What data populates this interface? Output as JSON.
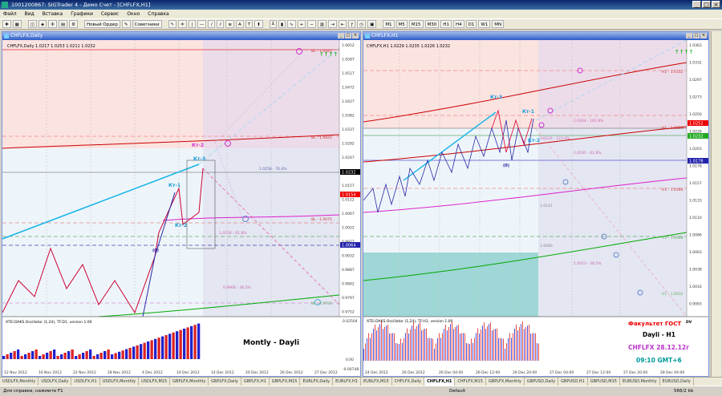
{
  "app": {
    "title": "1001200867: SIGTrader 4 - Демо Счет - [CHFLFX,H1]"
  },
  "menu": [
    "Файл",
    "Вид",
    "Вставка",
    "Графики",
    "Сервис",
    "Окно",
    "Справка"
  ],
  "toolbar": {
    "new_order": "Новый Ордер",
    "advisors": "Советники",
    "timeframes": [
      "M1",
      "M5",
      "M15",
      "M30",
      "H1",
      "H4",
      "D1",
      "W1",
      "MN"
    ]
  },
  "left_chart": {
    "title": "CHFLFX,Daily",
    "info": "CHFLFX,Daily 1.0217 1.0253 1.0211 1.0232",
    "price_scale": [
      "1.0652",
      "1.0587",
      "1.0517",
      "1.0472",
      "1.0427",
      "1.0382",
      "1.0337",
      "1.0292",
      "1.0247",
      "1.0202",
      "1.0157",
      "1.0112",
      "1.0067",
      "1.0022",
      "0.9977",
      "0.9932",
      "0.9887",
      "0.9842",
      "0.9797",
      "0.9752"
    ],
    "current_price": "1.0232",
    "red_tag": "1.0154",
    "blue_tag": "1.0064",
    "level_labels": [
      "BL - 1.0441",
      "BL - 1.0075",
      "1.0258 - 76.4%",
      "1.0156 - 61.8%",
      "1.0088 - 50.0%",
      "0.9908 - 38.2%",
      "BL - 0.9781"
    ],
    "wave_labels": {
      "kr2": "Кт-2",
      "kr3": "Кт-3",
      "kr1": "Кт-1",
      "kr2b": "Кт-2",
      "zero": "(0)"
    },
    "osc_title": "ATEI.DAKS.Oscillator (1,24), TF:D1, version 1.00",
    "osc_scale": [
      "0.02504",
      "0.00",
      "-0.00748"
    ],
    "note": "Montly - Dayli",
    "dates": [
      "12 Nov 2012",
      "16 Nov 2012",
      "22 Nov 2012",
      "28 Nov 2012",
      "4 Dec 2012",
      "10 Dec 2012",
      "14 Dec 2012",
      "20 Dec 2012",
      "26 Dec 2012",
      "27 Dec 2012"
    ]
  },
  "right_chart": {
    "title": "CHFLFX,H1",
    "info": "CHFLFX,H1 1.0229 1.0235 1.0226 1.0232",
    "price_scale": [
      "1.0363",
      "1.0332",
      "1.0297",
      "1.0273",
      "1.0250",
      "1.0226",
      "1.0203",
      "1.0178",
      "1.0157",
      "1.0133",
      "1.0110",
      "1.0086",
      "1.0063",
      "1.0038",
      "1.0016",
      "0.9993"
    ],
    "current_price": "1.0252",
    "green_tag": "1.0232",
    "blue_tag": "1.0178",
    "level_labels": [
      "H1 - 1.0312",
      "1.0244 - 161.8%",
      "H1 - 1.0239",
      "1.0226 - 123.6%",
      "1.0195 - 61.8%",
      "H1 - 1.0164",
      "1.0141",
      "H1 - 1.0088",
      "1.0080",
      "1.0053 - 38.2%",
      "H1 - 1.0032"
    ],
    "wave_labels": {
      "kr3": "Кт-3",
      "kr1": "Кт-1",
      "kr2": "Кт-2",
      "zero": "(0)"
    },
    "osc_title": "ATEI.DAKS.Oscillator (1,24), TF:H1, version 1.00",
    "dates": [
      "24 Dec 2012",
      "26 Dec 2012",
      "26 Dec 04:00",
      "26 Dec 12:00",
      "26 Dec 20:00",
      "27 Dec 04:00",
      "27 Dec 12:00",
      "27 Dec 20:00",
      "28 Dec 04:00"
    ],
    "annotation": {
      "line1": "Факультет ГОСТ",
      "line1_suffix": "DV",
      "line2": "Dayli - H1",
      "line3": "CHFLFX 28.12.12г",
      "line4": "09:10 GMT+6"
    }
  },
  "tabs": [
    "USDLFX,Monthly",
    "USDLFX,Daily",
    "USDLFX,H1",
    "USDLFX,Monthly",
    "USDLFX,M15",
    "GBPLFX,Monthly",
    "GBPLFX,Daily",
    "GBPLFX,H1",
    "GBPLFX,M15",
    "EURLFX,Daily",
    "EURLFX,H1",
    "EURLFX,M15",
    "CHFLFX,Daily",
    "CHFLFX,H1",
    "CHFLFX,M15",
    "GBPLFX,Monthly",
    "GBPUSD,Daily",
    "GBPUSD,H1",
    "GBPUSD,M15",
    "EURUSD,Monthly",
    "EURUSD,Daily"
  ],
  "active_tab": "CHFLFX,H1",
  "status": {
    "help": "Для справки, нажмите F1",
    "profile": "Default",
    "traffic": "566/2 kb"
  },
  "colors": {
    "titlebar": "#0a246a",
    "accent": "#2c5cc8"
  }
}
